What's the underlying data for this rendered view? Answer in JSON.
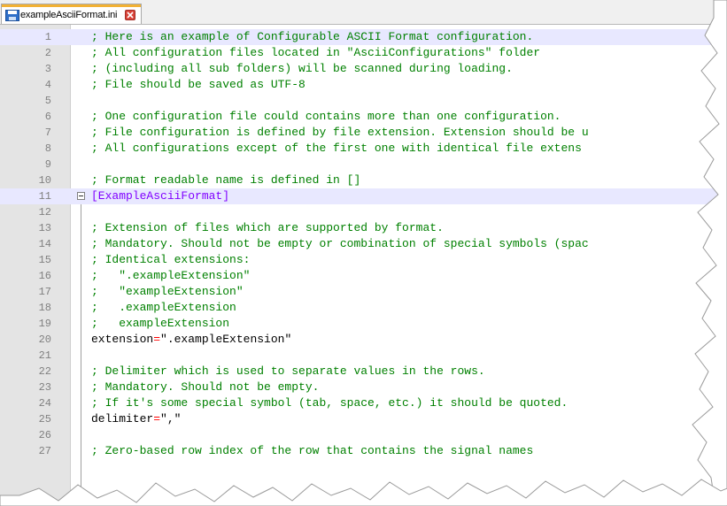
{
  "tab": {
    "title": "exampleAsciiFormat.ini",
    "icon": "save-icon",
    "close_icon": "close-icon"
  },
  "colors": {
    "comment": "#008000",
    "section": "#8000ff",
    "equals": "#ff0000",
    "current_line": "#e8e8ff",
    "gutter": "#e4e4e4"
  },
  "lines": [
    {
      "num": "1",
      "parts": [
        {
          "t": "; Here is an example of Configurable ASCII Format configuration.",
          "c": "comment"
        }
      ]
    },
    {
      "num": "2",
      "parts": [
        {
          "t": "; All configuration files located in \"AsciiConfigurations\" folder",
          "c": "comment"
        }
      ]
    },
    {
      "num": "3",
      "parts": [
        {
          "t": "; (including all sub folders) will be scanned during loading.",
          "c": "comment"
        }
      ]
    },
    {
      "num": "4",
      "parts": [
        {
          "t": "; File should be saved as UTF-8",
          "c": "comment"
        }
      ]
    },
    {
      "num": "5",
      "parts": []
    },
    {
      "num": "6",
      "parts": [
        {
          "t": "; One configuration file could contains more than one configuration.",
          "c": "comment"
        }
      ]
    },
    {
      "num": "7",
      "parts": [
        {
          "t": "; File configuration is defined by file extension. Extension should be u",
          "c": "comment"
        }
      ]
    },
    {
      "num": "8",
      "parts": [
        {
          "t": "; All configurations except of the first one with identical file extens",
          "c": "comment"
        }
      ]
    },
    {
      "num": "9",
      "parts": []
    },
    {
      "num": "10",
      "parts": [
        {
          "t": "; Format readable name is defined in []",
          "c": "comment"
        }
      ]
    },
    {
      "num": "11",
      "parts": [
        {
          "t": "[ExampleAsciiFormat]",
          "c": "section"
        }
      ]
    },
    {
      "num": "12",
      "parts": []
    },
    {
      "num": "13",
      "parts": [
        {
          "t": "; Extension of files which are supported by format.",
          "c": "comment"
        }
      ]
    },
    {
      "num": "14",
      "parts": [
        {
          "t": "; Mandatory. Should not be empty or combination of special symbols (spac",
          "c": "comment"
        }
      ]
    },
    {
      "num": "15",
      "parts": [
        {
          "t": "; Identical extensions:",
          "c": "comment"
        }
      ]
    },
    {
      "num": "16",
      "parts": [
        {
          "t": ";   \".exampleExtension\"",
          "c": "comment"
        }
      ]
    },
    {
      "num": "17",
      "parts": [
        {
          "t": ";   \"exampleExtension\"",
          "c": "comment"
        }
      ]
    },
    {
      "num": "18",
      "parts": [
        {
          "t": ";   .exampleExtension",
          "c": "comment"
        }
      ]
    },
    {
      "num": "19",
      "parts": [
        {
          "t": ";   exampleExtension",
          "c": "comment"
        }
      ]
    },
    {
      "num": "20",
      "parts": [
        {
          "t": "extension",
          "c": "key"
        },
        {
          "t": "=",
          "c": "eq"
        },
        {
          "t": "\".exampleExtension\"",
          "c": "val"
        }
      ]
    },
    {
      "num": "21",
      "parts": []
    },
    {
      "num": "22",
      "parts": [
        {
          "t": "; Delimiter which is used to separate values in the rows.",
          "c": "comment"
        }
      ]
    },
    {
      "num": "23",
      "parts": [
        {
          "t": "; Mandatory. Should not be empty.",
          "c": "comment"
        }
      ]
    },
    {
      "num": "24",
      "parts": [
        {
          "t": "; If it's some special symbol (tab, space, etc.) it should be quoted.",
          "c": "comment"
        }
      ]
    },
    {
      "num": "25",
      "parts": [
        {
          "t": "delimiter",
          "c": "key"
        },
        {
          "t": "=",
          "c": "eq"
        },
        {
          "t": "\",\"",
          "c": "val"
        }
      ]
    },
    {
      "num": "26",
      "parts": []
    },
    {
      "num": "27",
      "parts": [
        {
          "t": "; Zero-based row index of the row that contains the signal names",
          "c": "comment"
        }
      ]
    }
  ]
}
